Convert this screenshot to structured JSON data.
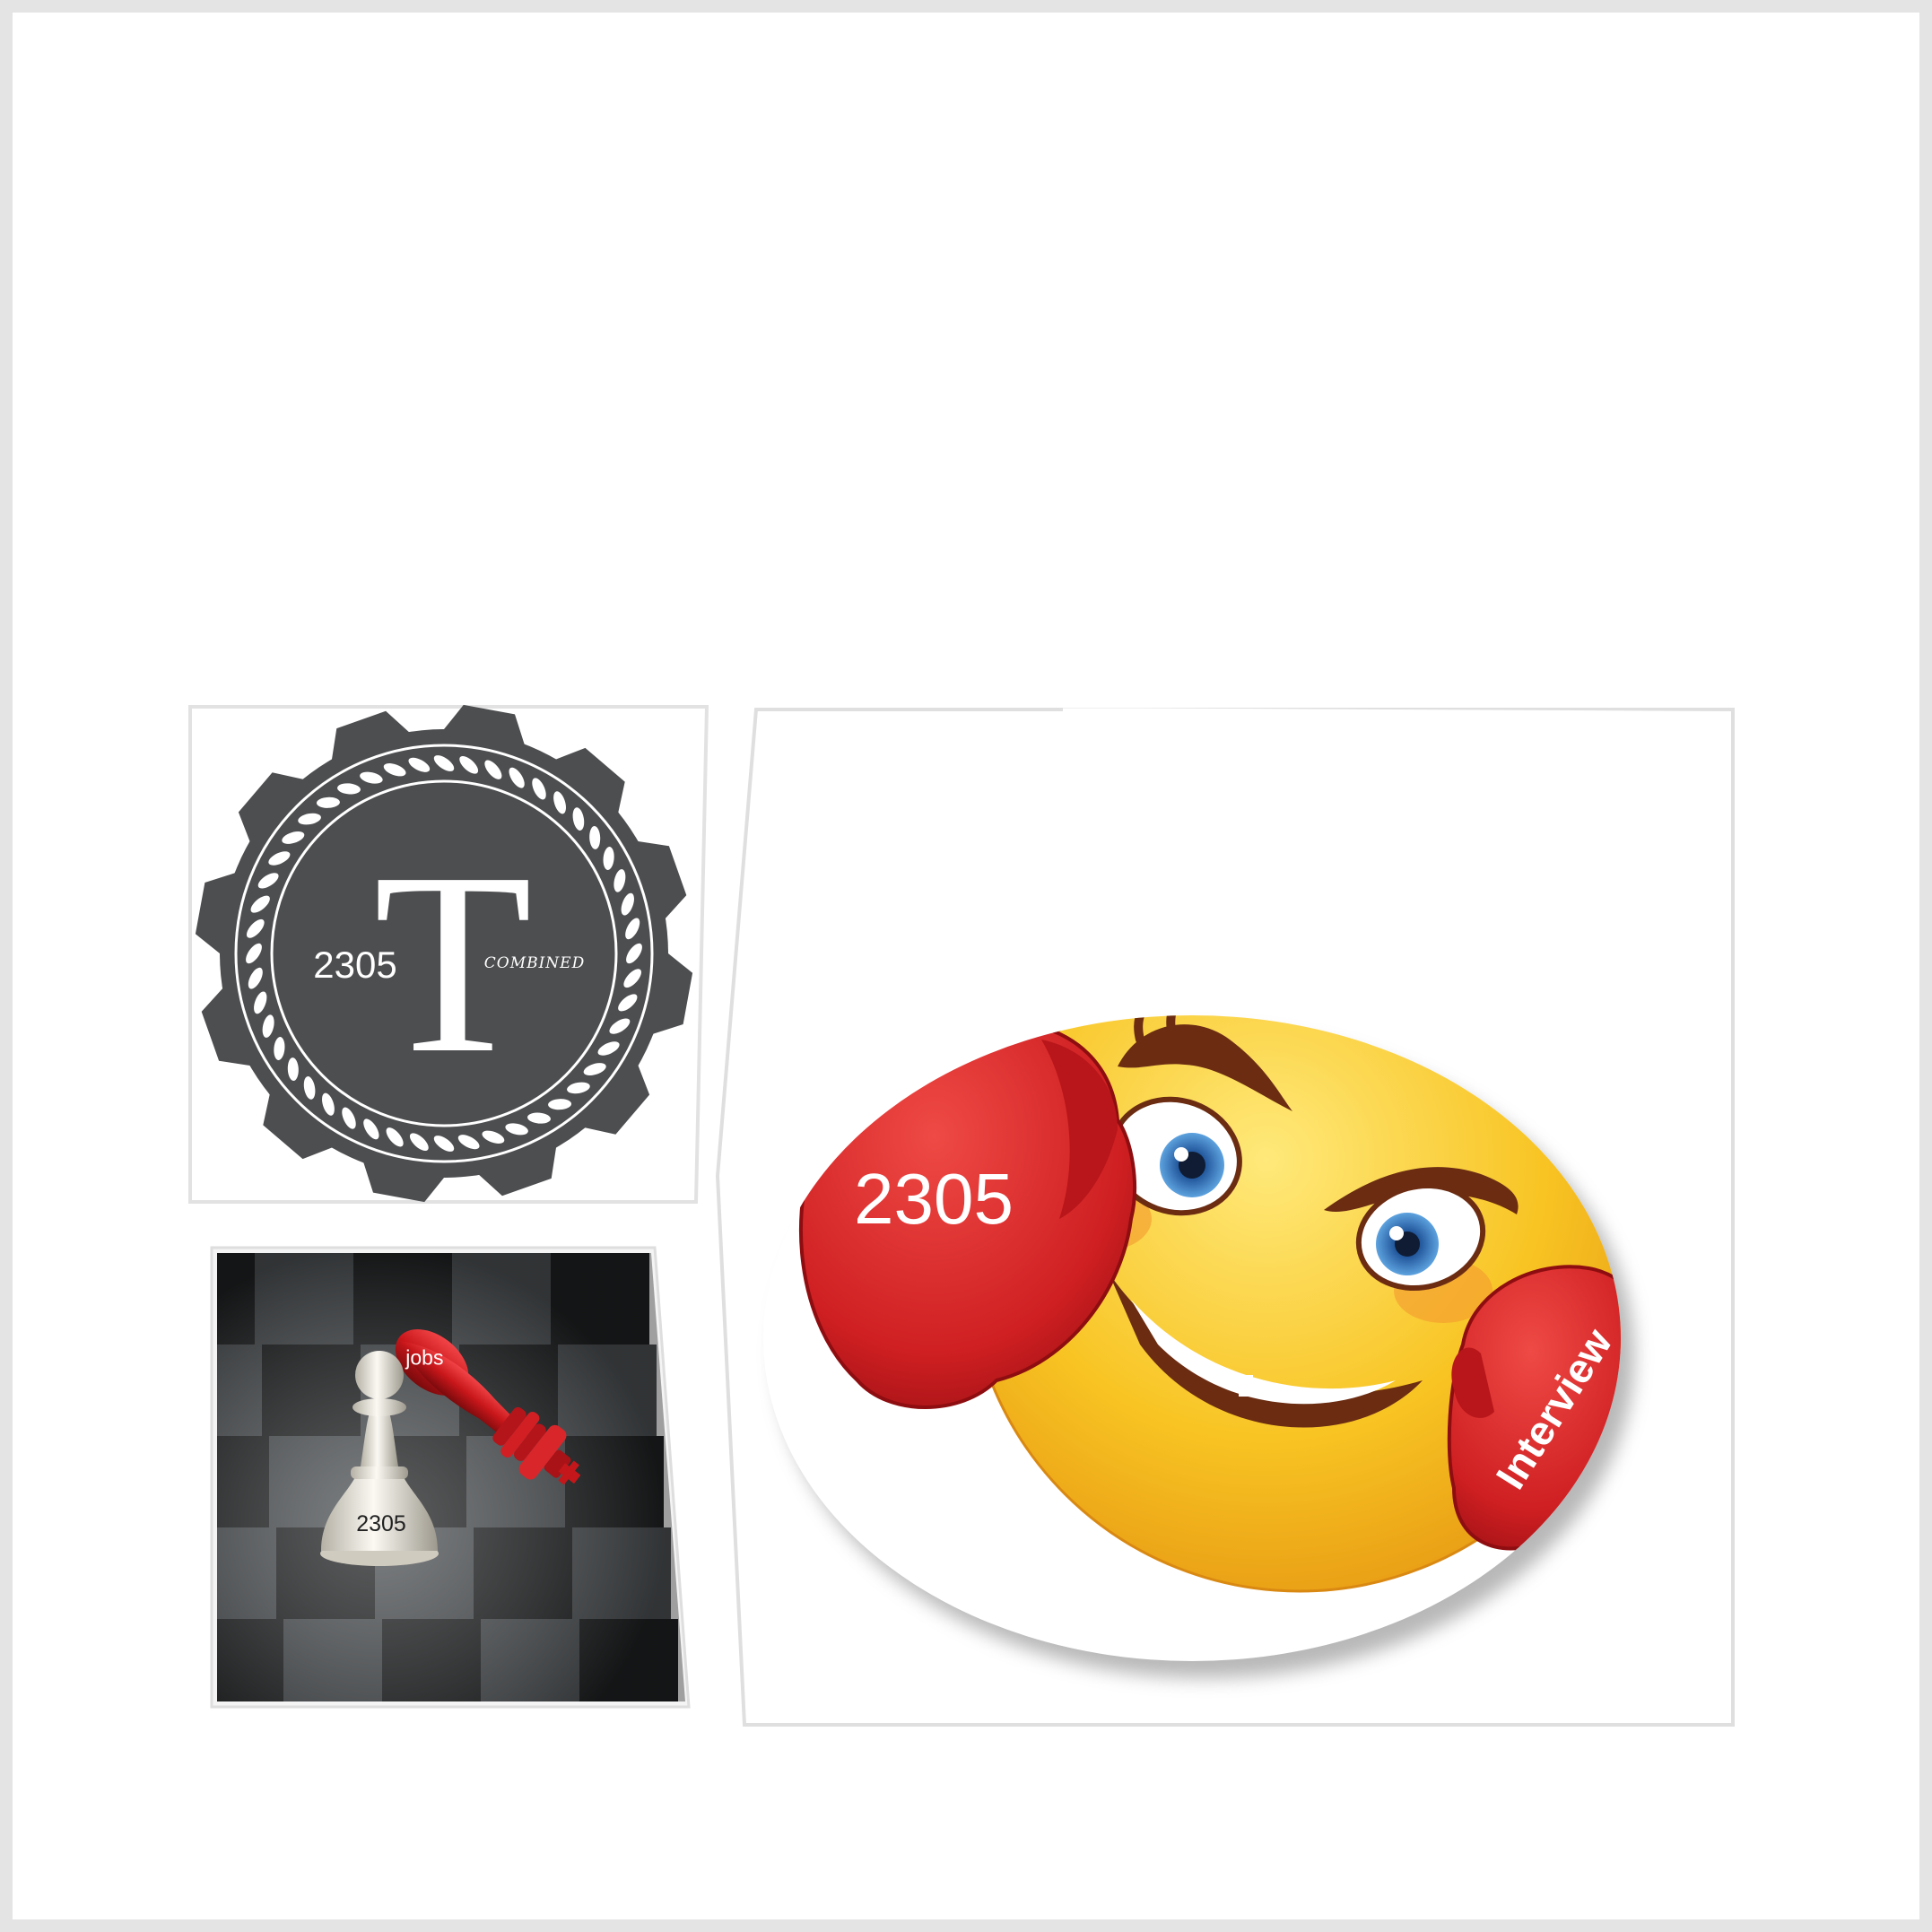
{
  "badge": {
    "letter": "T",
    "number": "2305",
    "tagline": "COMBINED",
    "colors": {
      "disc": "#4d4e50",
      "ink": "#ffffff"
    }
  },
  "chess": {
    "pawn_label": "2305",
    "king_label": "jobs",
    "colors": {
      "board_dark": "#1e2021",
      "board_light": "#4b4f52",
      "king": "#d21a1c",
      "pawn": "#e9e6dc"
    }
  },
  "emoji": {
    "glove_left_label": "2305",
    "glove_right_label": "Interview",
    "icons": [
      "boxing-glove-icon",
      "bandage-icon",
      "smiley-face-icon"
    ],
    "colors": {
      "face": "#f7c21f",
      "glove": "#d41f22",
      "eye": "#2f6fb4"
    }
  }
}
